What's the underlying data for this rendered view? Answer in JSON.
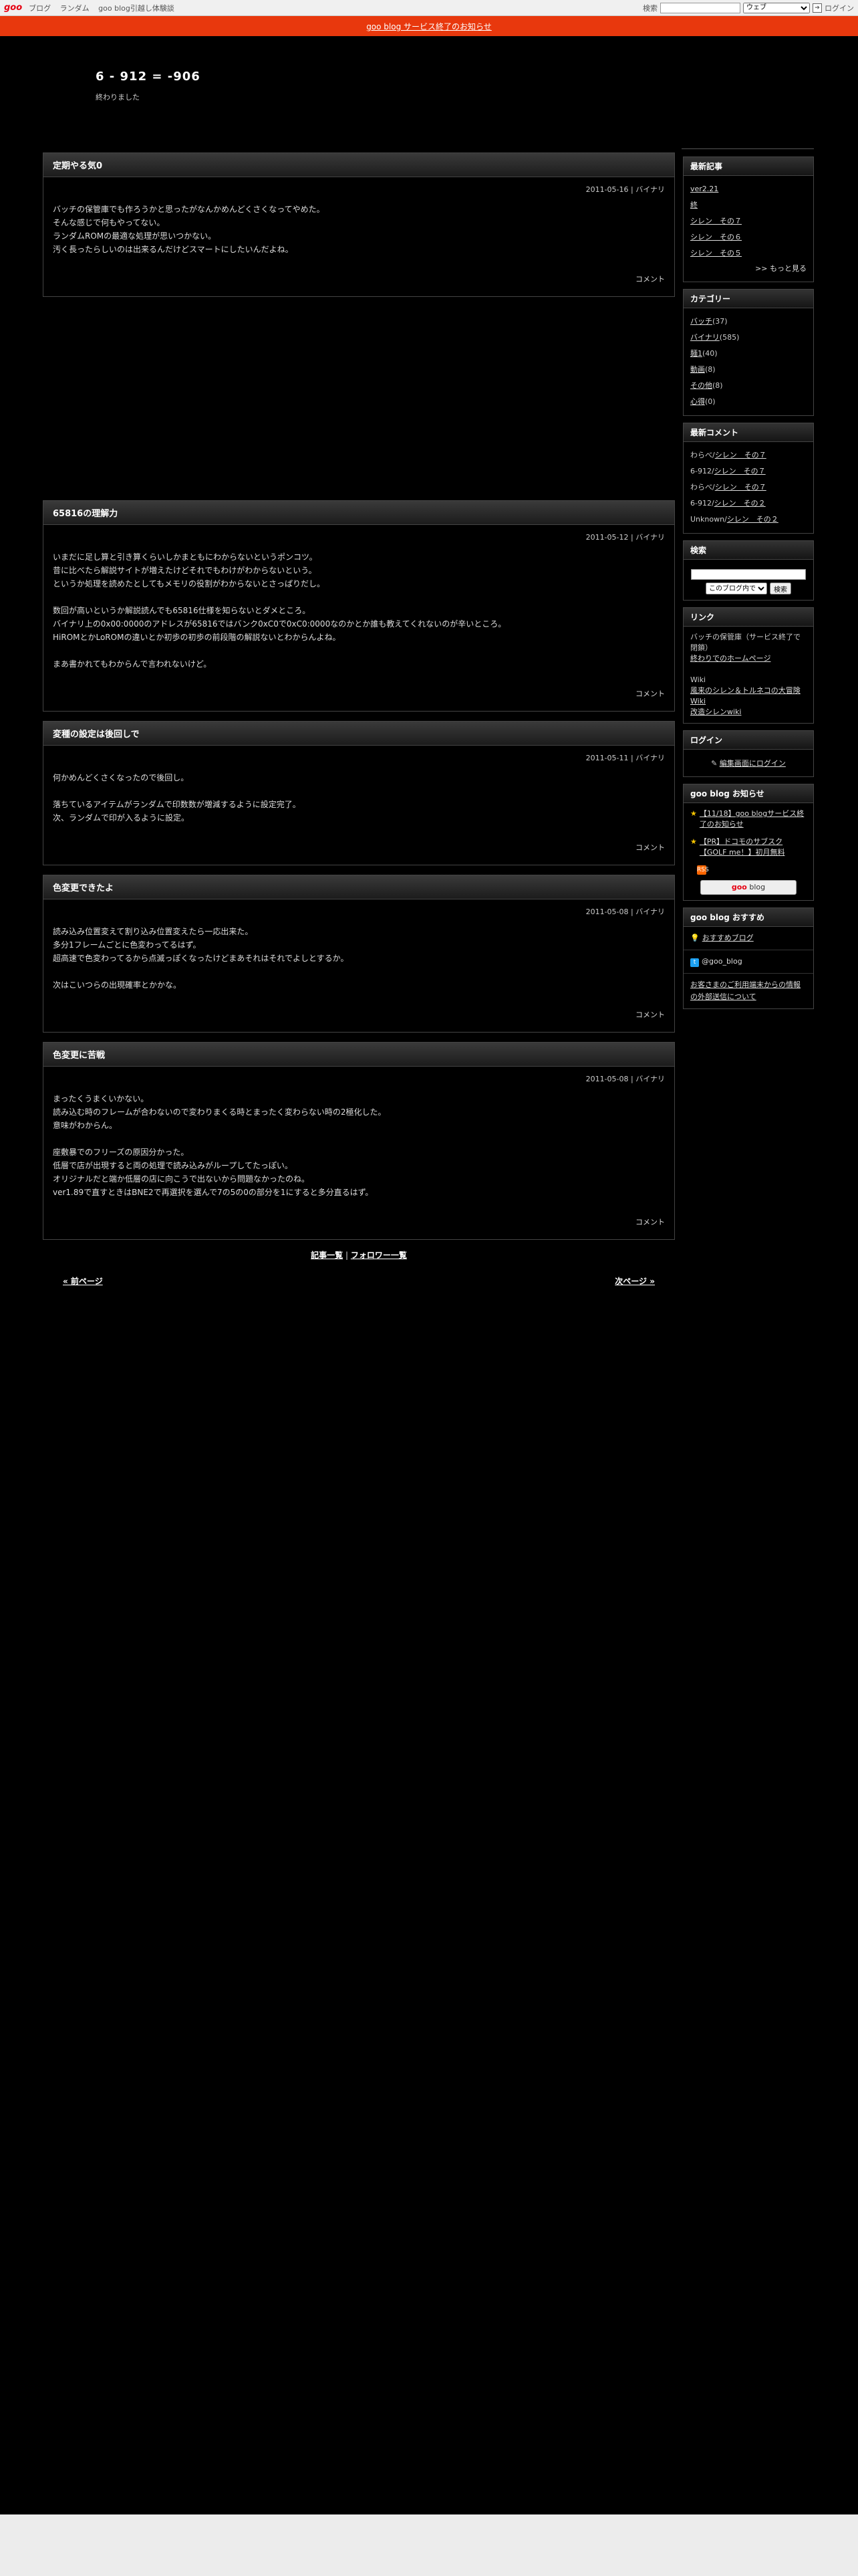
{
  "topbar": {
    "logo": "goo",
    "nav": [
      "ブログ",
      "ランダム",
      "goo blog引越し体験談"
    ],
    "search_label": "検索",
    "search_scope": "ウェブ",
    "go_icon": "search-go-icon",
    "login": "ログイン"
  },
  "notice": {
    "text": "goo blog サービス終了のお知らせ"
  },
  "blog": {
    "title": "6 - 912 = -906",
    "subtitle": "終わりました"
  },
  "entries": [
    {
      "title": "定期やる気0",
      "date": "2011-05-16",
      "category": "バイナリ",
      "body": "バッチの保管庫でも作ろうかと思ったがなんかめんどくさくなってやめた。\nそんな感じで何もやってない。\nランダムROMの最適な処理が思いつかない。\n汚く長ったらしいのは出来るんだけどスマートにしたいんだよね。",
      "comment": "コメント"
    },
    {
      "title": "65816の理解力",
      "date": "2011-05-12",
      "category": "バイナリ",
      "body": "いまだに足し算と引き算くらいしかまともにわからないというポンコツ。\n昔に比べたら解説サイトが増えたけどそれでもわけがわからないという。\nというか処理を読めたとしてもメモリの役割がわからないとさっぱりだし。\n\n数回が高いというか解説読んでも65816仕様を知らないとダメところ。\nバイナリ上の0x00:0000のアドレスが65816ではバンク0xC0で0xC0:0000なのかとか誰も教えてくれないのが辛いところ。\nHiROMとかLoROMの違いとか初歩の初歩の前段階の解説ないとわからんよね。\n\nまあ書かれてもわからんで言われないけど。",
      "comment": "コメント"
    },
    {
      "title": "変種の設定は後回しで",
      "date": "2011-05-11",
      "category": "バイナリ",
      "body": "何かめんどくさくなったので後回し。\n\n落ちているアイテムがランダムで印数数が増減するように設定完了。\n次、ランダムで印が入るように設定。",
      "comment": "コメント"
    },
    {
      "title": "色変更できたよ",
      "date": "2011-05-08",
      "category": "バイナリ",
      "body": "読み込み位置変えて割り込み位置変えたら一応出来た。\n多分1フレームごとに色変わってるはず。\n超高速で色変わってるから点滅っぽくなったけどまあそれはそれでよしとするか。\n\n次はこいつらの出現確率とかかな。",
      "comment": "コメント"
    },
    {
      "title": "色変更に苦戦",
      "date": "2011-05-08",
      "category": "バイナリ",
      "body": "まったくうまくいかない。\n読み込む時のフレームが合わないので変わりまくる時とまったく変わらない時の2極化した。\n意味がわからん。\n\n座敷暴でのフリーズの原因分かった。\n低層で店が出現すると両の処理で読み込みがループしてたっぽい。\nオリジナルだと端か低層の店に向こうで出ないから問題なかったのね。\nver1.89で直すときはBNE2で再選択を選んで7の5の0の部分を1にすると多分直るはず。",
      "comment": "コメント"
    }
  ],
  "footnav": {
    "list": "記事一覧",
    "sep": "|",
    "follow": "フォロワー一覧"
  },
  "pager": {
    "prev": "« 前ページ",
    "next": "次ページ »"
  },
  "sidebar": {
    "recent_title": "最新記事",
    "recent": [
      "ver2.21",
      "終",
      "シレン　その７",
      "シレン　その６",
      "シレン　その５"
    ],
    "recent_more": ">> もっと見る",
    "category_title": "カテゴリー",
    "categories": [
      {
        "name": "バッチ",
        "count": "(37)"
      },
      {
        "name": "バイナリ",
        "count": "(585)"
      },
      {
        "name": "麺1",
        "count": "(40)"
      },
      {
        "name": "動画",
        "count": "(8)"
      },
      {
        "name": "その他",
        "count": "(8)"
      },
      {
        "name": "心得",
        "count": "(0)"
      }
    ],
    "comments_title": "最新コメント",
    "comments": [
      {
        "user": "わらべ/",
        "post": "シレン　その７"
      },
      {
        "user": "6-912/",
        "post": "シレン　その７"
      },
      {
        "user": "わらべ/",
        "post": "シレン　その７"
      },
      {
        "user": "6-912/",
        "post": "シレン　その２"
      },
      {
        "user": "Unknown/",
        "post": "シレン　その２"
      }
    ],
    "search_title": "検索",
    "search_scope": "このブログ内で",
    "search_button": "検索",
    "links_title": "リンク",
    "links_text": "バッチの保管庫（サービス終了で閉鎖）",
    "links": [
      "終わりでのホームページ"
    ],
    "wiki_label": "Wiki",
    "wiki_links": [
      "風来のシレン＆トルネコの大冒険 Wiki",
      "改造シレンwiki"
    ],
    "login_title": "ログイン",
    "login_link": "編集画面にログイン",
    "news_title": "goo blog お知らせ",
    "news": [
      "【11/18】goo blogサービス終了のお知らせ",
      "【PR】ドコモのサブスク【GOLF me！】初月無料"
    ],
    "rss_label": "RSS",
    "goo_btn_brand": "goo",
    "goo_btn_text": " blog",
    "reco_title": "goo blog おすすめ",
    "reco_link": "おすすめブログ",
    "twitter_link": "@goo_blog",
    "external_link": "お客さまのご利用端末からの情報の外部送信について"
  }
}
